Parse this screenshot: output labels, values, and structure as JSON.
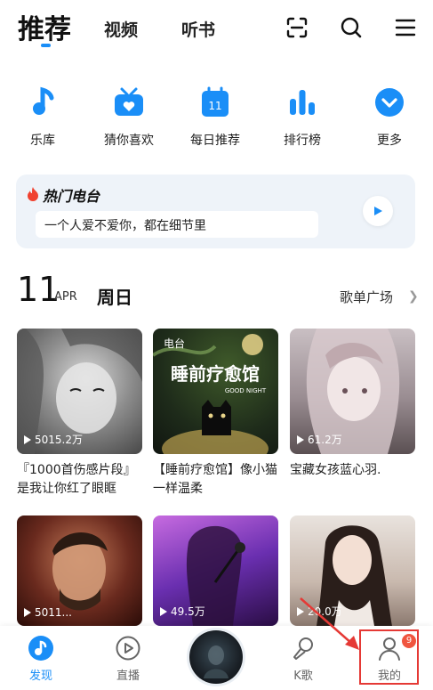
{
  "header": {
    "tabs": [
      "推荐",
      "视频",
      "听书"
    ]
  },
  "quick_entries": [
    {
      "label": "乐库",
      "icon": "music-note-icon"
    },
    {
      "label": "猜你喜欢",
      "icon": "radio-heart-icon"
    },
    {
      "label": "每日推荐",
      "icon": "calendar-icon",
      "day": "11"
    },
    {
      "label": "排行榜",
      "icon": "ranking-bars-icon"
    },
    {
      "label": "更多",
      "icon": "chevron-down-circle-icon"
    }
  ],
  "radio": {
    "title": "热门电台",
    "text": "一个人爱不爱你，都在细节里"
  },
  "date": {
    "day": "11",
    "month": "APR",
    "weekday": "周日",
    "more": "歌单广场"
  },
  "playlists": [
    {
      "title": "『1000首伤感片段』是我让你红了眼眶",
      "plays": "5015.2万"
    },
    {
      "title": "【睡前疗愈馆】像小猫一样温柔",
      "tag": "电台",
      "cover_text": "睡前疗愈馆",
      "cover_sub": "GOOD NIGHT"
    },
    {
      "title": "宝藏女孩蓝心羽.",
      "plays": "61.2万"
    },
    {
      "title": "",
      "plays": "5011..."
    },
    {
      "title": "",
      "plays": "49.5万"
    },
    {
      "title": "",
      "plays": "20.0万"
    }
  ],
  "bottom_nav": [
    {
      "label": "发现",
      "icon": "discover-icon"
    },
    {
      "label": "直播",
      "icon": "live-play-icon"
    },
    {
      "label": "K歌",
      "icon": "microphone-icon"
    },
    {
      "label": "我的",
      "icon": "user-icon"
    }
  ],
  "badge": "9",
  "colors": {
    "accent": "#1a8ef7",
    "radio_bg": "#eef3f9",
    "badge": "#f0553f",
    "highlight": "#e53935"
  }
}
